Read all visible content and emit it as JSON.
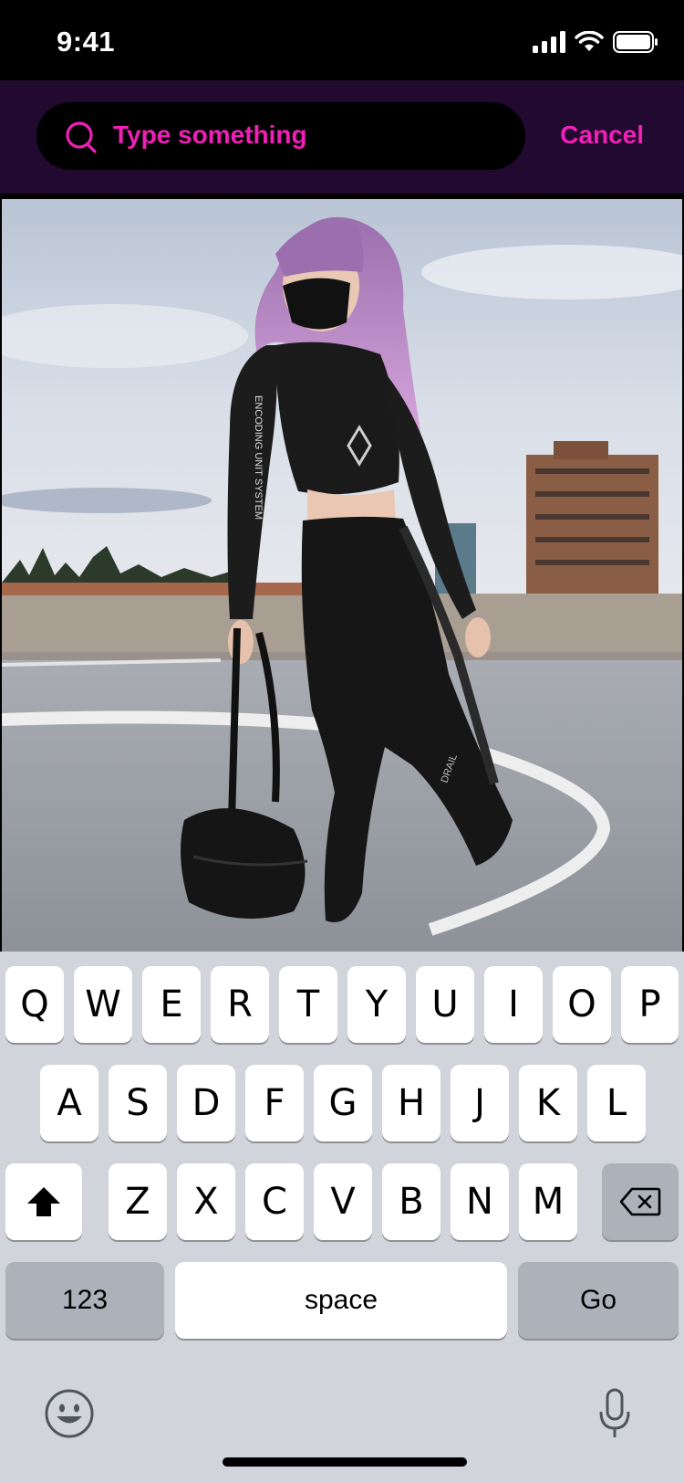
{
  "status_bar": {
    "time": "9:41",
    "icons": [
      "cellular-signal-icon",
      "wifi-icon",
      "battery-icon"
    ]
  },
  "search": {
    "placeholder": "Type something",
    "cancel_label": "Cancel",
    "accent_color": "#f01fb6",
    "header_bg": "#22092f"
  },
  "photo": {
    "description_icon": "photo-image",
    "sleeve_text": "ENCODING UNIT SYSTEM",
    "strap_text": "DRAIL"
  },
  "keyboard": {
    "row1": [
      "Q",
      "W",
      "E",
      "R",
      "T",
      "Y",
      "U",
      "I",
      "O",
      "P"
    ],
    "row2": [
      "A",
      "S",
      "D",
      "F",
      "G",
      "H",
      "J",
      "K",
      "L"
    ],
    "row3": [
      "Z",
      "X",
      "C",
      "V",
      "B",
      "N",
      "M"
    ],
    "numbers_label": "123",
    "space_label": "space",
    "go_label": "Go",
    "icons": [
      "shift-icon",
      "backspace-icon",
      "emoji-icon",
      "microphone-icon"
    ]
  }
}
